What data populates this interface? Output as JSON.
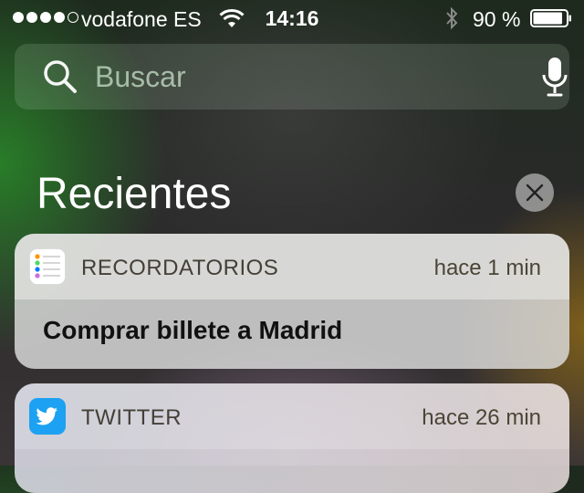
{
  "status_bar": {
    "signal_strength": 4,
    "signal_max": 5,
    "carrier": "vodafone ES",
    "time": "14:16",
    "battery_percent": "90 %",
    "battery_level": 0.9,
    "icons": [
      "wifi-icon",
      "bluetooth-icon",
      "battery-icon"
    ]
  },
  "search": {
    "placeholder": "Buscar",
    "value": "",
    "icons": [
      "search-icon",
      "microphone-icon"
    ]
  },
  "recents": {
    "title": "Recientes",
    "clear_icon": "close-icon"
  },
  "notifications": [
    {
      "app": "RECORDATORIOS",
      "icon": "reminders-app-icon",
      "time": "hace 1 min",
      "body": "Comprar billete a Madrid"
    },
    {
      "app": "TWITTER",
      "icon": "twitter-app-icon",
      "time": "hace 26 min",
      "accent": "#1DA1F2"
    }
  ]
}
